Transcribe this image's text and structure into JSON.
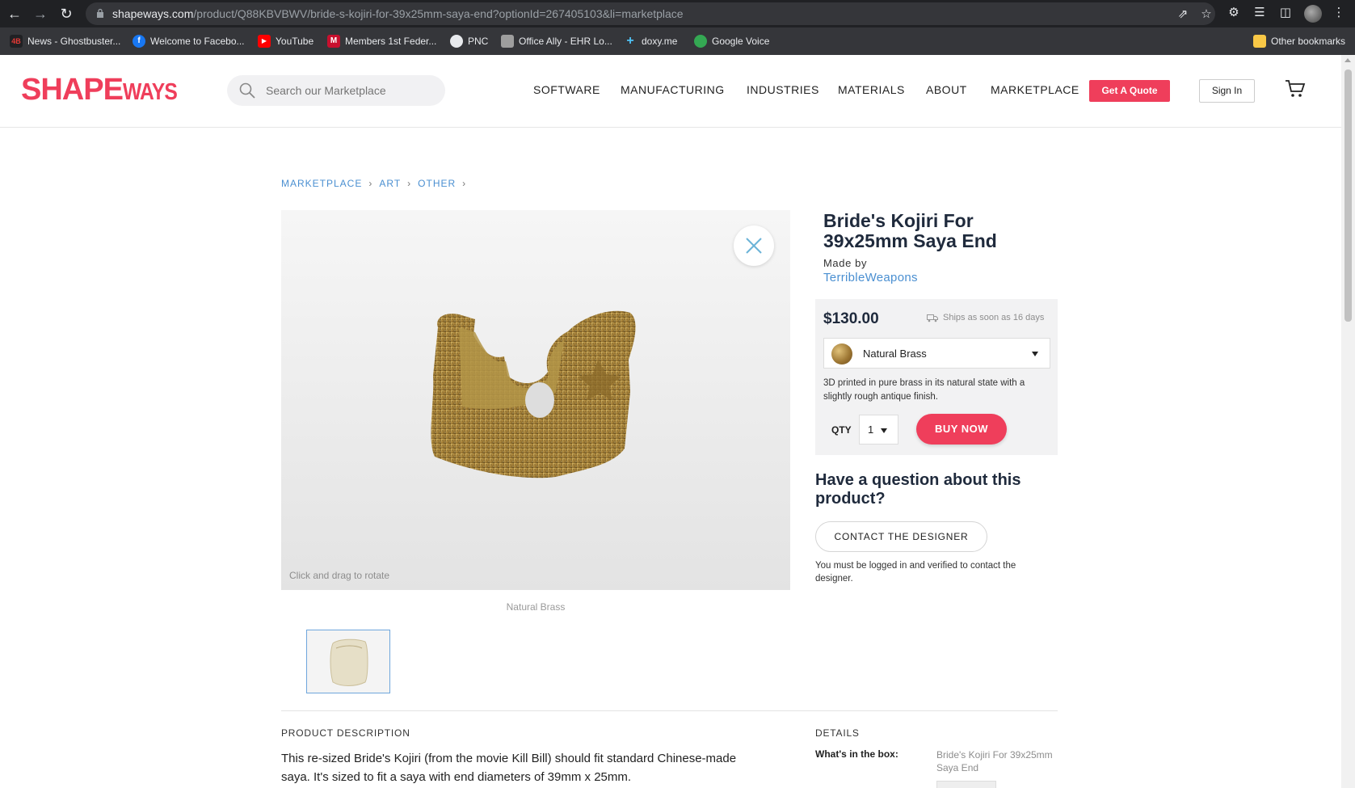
{
  "browser": {
    "url_host": "shapeways.com",
    "url_path": "/product/Q88KBVBWV/bride-s-kojiri-for-39x25mm-saya-end?optionId=267405103&li=marketplace",
    "bookmarks": [
      {
        "label": "News - Ghostbuster...",
        "color": "#c62828",
        "glyph": "4B"
      },
      {
        "label": "Welcome to Facebo...",
        "color": "#1877f2",
        "glyph": "f"
      },
      {
        "label": "YouTube",
        "color": "#ff0000",
        "glyph": "▶"
      },
      {
        "label": "Members 1st Feder...",
        "color": "#c8102e",
        "glyph": "M"
      },
      {
        "label": "PNC",
        "color": "#e8eaed",
        "glyph": ""
      },
      {
        "label": "Office Ally - EHR Lo...",
        "color": "#9e9e9e",
        "glyph": ""
      },
      {
        "label": "doxy.me",
        "color": "#4fc3f7",
        "glyph": "+"
      },
      {
        "label": "Google Voice",
        "color": "#34a853",
        "glyph": ""
      }
    ],
    "other_bookmarks": "Other bookmarks"
  },
  "header": {
    "logo_a": "SHAPE",
    "logo_b": "WAYS",
    "search_placeholder": "Search our Marketplace",
    "nav": [
      "SOFTWARE",
      "MANUFACTURING",
      "INDUSTRIES",
      "MATERIALS",
      "ABOUT",
      "MARKETPLACE"
    ],
    "quote_label": "Get A Quote",
    "signin_label": "Sign In"
  },
  "breadcrumb": [
    "MARKETPLACE",
    "ART",
    "OTHER"
  ],
  "viewer": {
    "hint": "Click and drag to rotate",
    "caption": "Natural Brass"
  },
  "product": {
    "title": "Bride's Kojiri For 39x25mm Saya End",
    "made_by": "Made by",
    "designer": "TerribleWeapons",
    "price": "$130.00",
    "ships": "Ships as soon as 16 days",
    "material": "Natural Brass",
    "material_desc": "3D printed in pure brass in its natural state with a slightly rough antique finish.",
    "qty_label": "QTY",
    "qty_value": "1",
    "buy_label": "BUY NOW"
  },
  "question": {
    "title": "Have a question about this product?",
    "contact_label": "CONTACT THE DESIGNER",
    "note": "You must be logged in and verified to contact the designer."
  },
  "description": {
    "heading": "PRODUCT DESCRIPTION",
    "text": "This re-sized Bride's Kojiri (from the movie Kill Bill) should fit standard Chinese-made saya.  It's sized to fit a saya with end diameters of 39mm x 25mm."
  },
  "details": {
    "heading": "DETAILS",
    "label": "What's in the box:",
    "value": "Bride's Kojiri For 39x25mm Saya End"
  },
  "colors": {
    "brand": "#ef3e5b",
    "link": "#4a8fd1"
  }
}
